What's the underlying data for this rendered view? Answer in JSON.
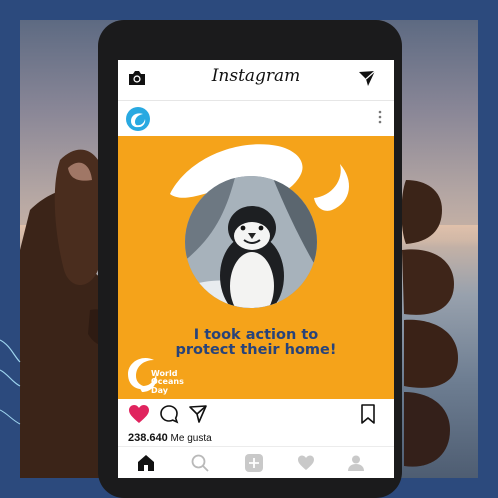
{
  "app": {
    "name": "Instagram"
  },
  "post": {
    "headline_line1": "I took action to",
    "headline_line2": "protect their home!",
    "brand_line1": "World",
    "brand_line2": "Oceans",
    "brand_line3": "Day",
    "likes_count": "238.640",
    "likes_label": "Me gusta"
  },
  "colors": {
    "frame": "#2c4a7d",
    "post_background": "#f5a31a",
    "headline": "#27437a",
    "like_heart": "#e0245e",
    "avatar": "#29a9e1"
  },
  "icons": {
    "top_left": "camera-icon",
    "top_right": "send-icon",
    "post_more": "more-options-icon",
    "actions": [
      "heart-icon",
      "comment-icon",
      "share-icon",
      "bookmark-icon"
    ],
    "nav": [
      "home-icon",
      "search-icon",
      "add-icon",
      "activity-icon",
      "profile-icon"
    ]
  }
}
